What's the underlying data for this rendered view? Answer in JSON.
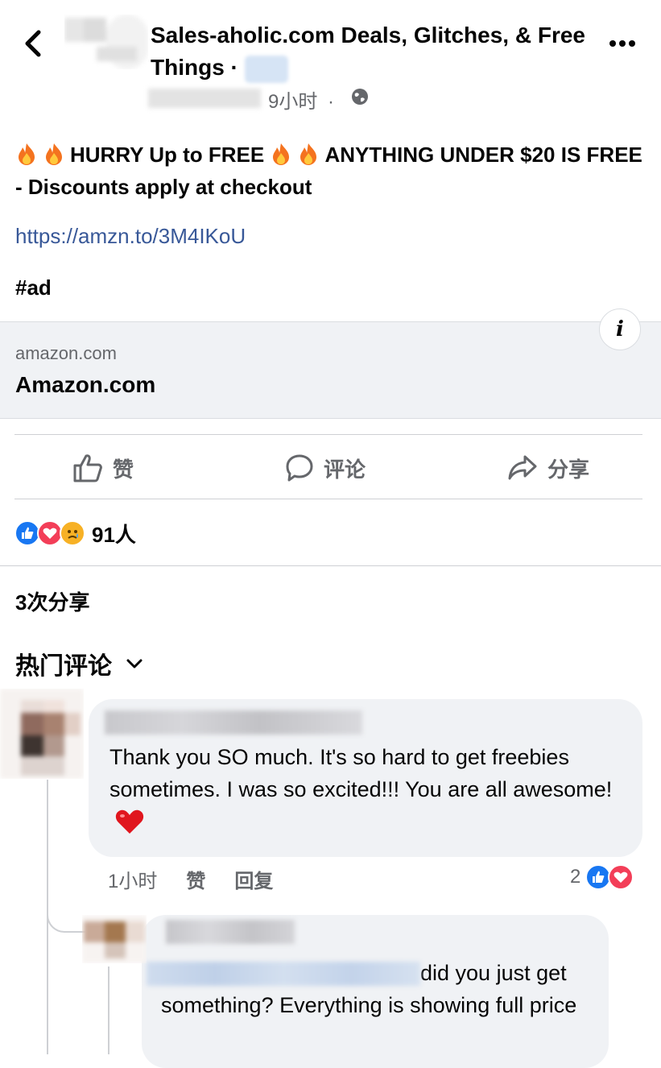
{
  "header": {
    "group_name": "Sales-aholic.com Deals, Glitches, & Free Things",
    "separator": "·",
    "time": "9小时",
    "time_separator": "·",
    "privacy_icon": "globe-icon",
    "back_icon": "chevron-left-icon",
    "more_icon": "more-horizontal-icon"
  },
  "post": {
    "emoji": "fire",
    "text_part1": "HURRY Up to FREE",
    "text_part2": "ANYTHING UNDER $20 IS FREE - Discounts apply at checkout",
    "link": "https://amzn.to/3M4IKoU",
    "hashtag": "#ad"
  },
  "link_card": {
    "domain": "amazon.com",
    "title": "Amazon.com",
    "info_label": "i"
  },
  "actions": {
    "like": "赞",
    "comment": "评论",
    "share": "分享"
  },
  "stats": {
    "reactions": [
      "like",
      "love",
      "sad"
    ],
    "reaction_count": "91人",
    "share_count": "3次分享"
  },
  "comments_section": {
    "sort_label": "热门评论"
  },
  "comments": [
    {
      "text": "Thank you SO much. It's so hard to get freebies sometimes. I was so excited!!! You are all awesome!",
      "time": "1小时",
      "like": "赞",
      "reply": "回复",
      "reaction_count": "2",
      "reactions": [
        "like",
        "love"
      ]
    },
    {
      "text": "did you just get something?  Everything is showing full price"
    }
  ],
  "colors": {
    "link": "#385898",
    "secondary_text": "#65676b",
    "bubble_bg": "#f0f2f5",
    "like_blue": "#1877f2",
    "love_red": "#f33e58",
    "sad_yellow": "#f7b125"
  }
}
